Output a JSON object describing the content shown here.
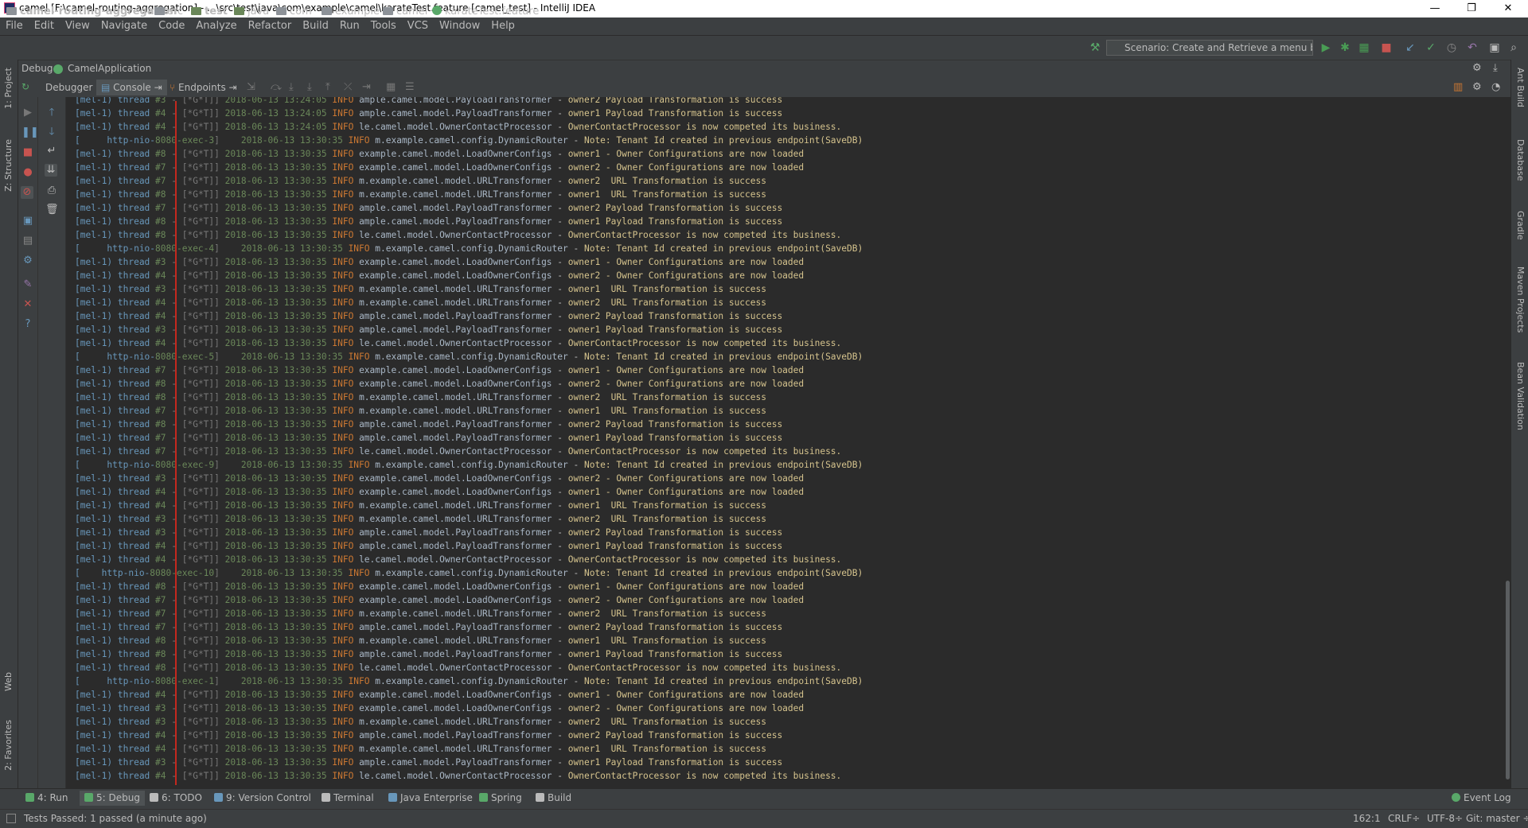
{
  "window": {
    "title": "camel [F:\\camel-routing-aggregation] - ...\\src\\test\\java\\com\\example\\camel\\karateTest.feature [camel_test] - IntelliJ IDEA",
    "controls": [
      "—",
      "❐",
      "✕"
    ]
  },
  "menu": [
    "File",
    "Edit",
    "View",
    "Navigate",
    "Code",
    "Analyze",
    "Refactor",
    "Build",
    "Run",
    "Tools",
    "VCS",
    "Window",
    "Help"
  ],
  "breadcrumbs": [
    "camel-routing-aggregation",
    "src",
    "test",
    "java",
    "com",
    "example",
    "camel",
    "karateTest.feature"
  ],
  "run_config": "Scenario: Create and Retrieve a menu by ...",
  "debug": {
    "header_label": "Debug",
    "config_name": "CamelApplication",
    "tabs": [
      "Debugger",
      "Console",
      "Endpoints"
    ]
  },
  "right_tools": [
    "Ant Build",
    "Database",
    "Gradle",
    "Maven Projects",
    "Bean Validation"
  ],
  "left_tools": [
    "1: Project",
    "Z: Structure",
    "Web",
    "2: Favorites"
  ],
  "console_lines": [
    [
      "[mel-1) thread ",
      "#3",
      " - [*G*T]] ",
      "2018-06-13 13:24:05",
      "INFO",
      "ample.camel.model.PayloadTransformer",
      "owner2 Payload Transformation is success"
    ],
    [
      "[mel-1) thread ",
      "#4",
      " - [*G*T]] ",
      "2018-06-13 13:24:05",
      "INFO",
      "ample.camel.model.PayloadTransformer",
      "owner1 Payload Transformation is success"
    ],
    [
      "[mel-1) thread ",
      "#4",
      " - [*G*T]] ",
      "2018-06-13 13:24:05",
      "INFO",
      "le.camel.model.OwnerContactProcessor",
      "OwnerContactProcessor is now competed its business."
    ],
    [
      "[     http-nio-",
      "8080-exec-3",
      "]    ",
      "2018-06-13 13:30:35",
      "INFO",
      "m.example.camel.config.DynamicRouter",
      "Note: Tenant Id created in previous endpoint(SaveDB)"
    ],
    [
      "[mel-1) thread ",
      "#8",
      " - [*G*T]] ",
      "2018-06-13 13:30:35",
      "INFO",
      "example.camel.model.LoadOwnerConfigs",
      "owner1 - Owner Configurations are now loaded"
    ],
    [
      "[mel-1) thread ",
      "#7",
      " - [*G*T]] ",
      "2018-06-13 13:30:35",
      "INFO",
      "example.camel.model.LoadOwnerConfigs",
      "owner2 - Owner Configurations are now loaded"
    ],
    [
      "[mel-1) thread ",
      "#7",
      " - [*G*T]] ",
      "2018-06-13 13:30:35",
      "INFO",
      "m.example.camel.model.URLTransformer",
      "owner2  URL Transformation is success"
    ],
    [
      "[mel-1) thread ",
      "#8",
      " - [*G*T]] ",
      "2018-06-13 13:30:35",
      "INFO",
      "m.example.camel.model.URLTransformer",
      "owner1  URL Transformation is success"
    ],
    [
      "[mel-1) thread ",
      "#7",
      " - [*G*T]] ",
      "2018-06-13 13:30:35",
      "INFO",
      "ample.camel.model.PayloadTransformer",
      "owner2 Payload Transformation is success"
    ],
    [
      "[mel-1) thread ",
      "#8",
      " - [*G*T]] ",
      "2018-06-13 13:30:35",
      "INFO",
      "ample.camel.model.PayloadTransformer",
      "owner1 Payload Transformation is success"
    ],
    [
      "[mel-1) thread ",
      "#8",
      " - [*G*T]] ",
      "2018-06-13 13:30:35",
      "INFO",
      "le.camel.model.OwnerContactProcessor",
      "OwnerContactProcessor is now competed its business."
    ],
    [
      "[     http-nio-",
      "8080-exec-4",
      "]    ",
      "2018-06-13 13:30:35",
      "INFO",
      "m.example.camel.config.DynamicRouter",
      "Note: Tenant Id created in previous endpoint(SaveDB)"
    ],
    [
      "[mel-1) thread ",
      "#3",
      " - [*G*T]] ",
      "2018-06-13 13:30:35",
      "INFO",
      "example.camel.model.LoadOwnerConfigs",
      "owner1 - Owner Configurations are now loaded"
    ],
    [
      "[mel-1) thread ",
      "#4",
      " - [*G*T]] ",
      "2018-06-13 13:30:35",
      "INFO",
      "example.camel.model.LoadOwnerConfigs",
      "owner2 - Owner Configurations are now loaded"
    ],
    [
      "[mel-1) thread ",
      "#3",
      " - [*G*T]] ",
      "2018-06-13 13:30:35",
      "INFO",
      "m.example.camel.model.URLTransformer",
      "owner1  URL Transformation is success"
    ],
    [
      "[mel-1) thread ",
      "#4",
      " - [*G*T]] ",
      "2018-06-13 13:30:35",
      "INFO",
      "m.example.camel.model.URLTransformer",
      "owner2  URL Transformation is success"
    ],
    [
      "[mel-1) thread ",
      "#4",
      " - [*G*T]] ",
      "2018-06-13 13:30:35",
      "INFO",
      "ample.camel.model.PayloadTransformer",
      "owner2 Payload Transformation is success"
    ],
    [
      "[mel-1) thread ",
      "#3",
      " - [*G*T]] ",
      "2018-06-13 13:30:35",
      "INFO",
      "ample.camel.model.PayloadTransformer",
      "owner1 Payload Transformation is success"
    ],
    [
      "[mel-1) thread ",
      "#4",
      " - [*G*T]] ",
      "2018-06-13 13:30:35",
      "INFO",
      "le.camel.model.OwnerContactProcessor",
      "OwnerContactProcessor is now competed its business."
    ],
    [
      "[     http-nio-",
      "8080-exec-5",
      "]    ",
      "2018-06-13 13:30:35",
      "INFO",
      "m.example.camel.config.DynamicRouter",
      "Note: Tenant Id created in previous endpoint(SaveDB)"
    ],
    [
      "[mel-1) thread ",
      "#7",
      " - [*G*T]] ",
      "2018-06-13 13:30:35",
      "INFO",
      "example.camel.model.LoadOwnerConfigs",
      "owner1 - Owner Configurations are now loaded"
    ],
    [
      "[mel-1) thread ",
      "#8",
      " - [*G*T]] ",
      "2018-06-13 13:30:35",
      "INFO",
      "example.camel.model.LoadOwnerConfigs",
      "owner2 - Owner Configurations are now loaded"
    ],
    [
      "[mel-1) thread ",
      "#8",
      " - [*G*T]] ",
      "2018-06-13 13:30:35",
      "INFO",
      "m.example.camel.model.URLTransformer",
      "owner2  URL Transformation is success"
    ],
    [
      "[mel-1) thread ",
      "#7",
      " - [*G*T]] ",
      "2018-06-13 13:30:35",
      "INFO",
      "m.example.camel.model.URLTransformer",
      "owner1  URL Transformation is success"
    ],
    [
      "[mel-1) thread ",
      "#8",
      " - [*G*T]] ",
      "2018-06-13 13:30:35",
      "INFO",
      "ample.camel.model.PayloadTransformer",
      "owner2 Payload Transformation is success"
    ],
    [
      "[mel-1) thread ",
      "#7",
      " - [*G*T]] ",
      "2018-06-13 13:30:35",
      "INFO",
      "ample.camel.model.PayloadTransformer",
      "owner1 Payload Transformation is success"
    ],
    [
      "[mel-1) thread ",
      "#7",
      " - [*G*T]] ",
      "2018-06-13 13:30:35",
      "INFO",
      "le.camel.model.OwnerContactProcessor",
      "OwnerContactProcessor is now competed its business."
    ],
    [
      "[     http-nio-",
      "8080-exec-9",
      "]    ",
      "2018-06-13 13:30:35",
      "INFO",
      "m.example.camel.config.DynamicRouter",
      "Note: Tenant Id created in previous endpoint(SaveDB)"
    ],
    [
      "[mel-1) thread ",
      "#3",
      " - [*G*T]] ",
      "2018-06-13 13:30:35",
      "INFO",
      "example.camel.model.LoadOwnerConfigs",
      "owner2 - Owner Configurations are now loaded"
    ],
    [
      "[mel-1) thread ",
      "#4",
      " - [*G*T]] ",
      "2018-06-13 13:30:35",
      "INFO",
      "example.camel.model.LoadOwnerConfigs",
      "owner1 - Owner Configurations are now loaded"
    ],
    [
      "[mel-1) thread ",
      "#4",
      " - [*G*T]] ",
      "2018-06-13 13:30:35",
      "INFO",
      "m.example.camel.model.URLTransformer",
      "owner1  URL Transformation is success"
    ],
    [
      "[mel-1) thread ",
      "#3",
      " - [*G*T]] ",
      "2018-06-13 13:30:35",
      "INFO",
      "m.example.camel.model.URLTransformer",
      "owner2  URL Transformation is success"
    ],
    [
      "[mel-1) thread ",
      "#3",
      " - [*G*T]] ",
      "2018-06-13 13:30:35",
      "INFO",
      "ample.camel.model.PayloadTransformer",
      "owner2 Payload Transformation is success"
    ],
    [
      "[mel-1) thread ",
      "#4",
      " - [*G*T]] ",
      "2018-06-13 13:30:35",
      "INFO",
      "ample.camel.model.PayloadTransformer",
      "owner1 Payload Transformation is success"
    ],
    [
      "[mel-1) thread ",
      "#4",
      " - [*G*T]] ",
      "2018-06-13 13:30:35",
      "INFO",
      "le.camel.model.OwnerContactProcessor",
      "OwnerContactProcessor is now competed its business."
    ],
    [
      "[    http-nio-",
      "8080-exec-10",
      "]    ",
      "2018-06-13 13:30:35",
      "INFO",
      "m.example.camel.config.DynamicRouter",
      "Note: Tenant Id created in previous endpoint(SaveDB)"
    ],
    [
      "[mel-1) thread ",
      "#8",
      " - [*G*T]] ",
      "2018-06-13 13:30:35",
      "INFO",
      "example.camel.model.LoadOwnerConfigs",
      "owner1 - Owner Configurations are now loaded"
    ],
    [
      "[mel-1) thread ",
      "#7",
      " - [*G*T]] ",
      "2018-06-13 13:30:35",
      "INFO",
      "example.camel.model.LoadOwnerConfigs",
      "owner2 - Owner Configurations are now loaded"
    ],
    [
      "[mel-1) thread ",
      "#7",
      " - [*G*T]] ",
      "2018-06-13 13:30:35",
      "INFO",
      "m.example.camel.model.URLTransformer",
      "owner2  URL Transformation is success"
    ],
    [
      "[mel-1) thread ",
      "#7",
      " - [*G*T]] ",
      "2018-06-13 13:30:35",
      "INFO",
      "ample.camel.model.PayloadTransformer",
      "owner2 Payload Transformation is success"
    ],
    [
      "[mel-1) thread ",
      "#8",
      " - [*G*T]] ",
      "2018-06-13 13:30:35",
      "INFO",
      "m.example.camel.model.URLTransformer",
      "owner1  URL Transformation is success"
    ],
    [
      "[mel-1) thread ",
      "#8",
      " - [*G*T]] ",
      "2018-06-13 13:30:35",
      "INFO",
      "ample.camel.model.PayloadTransformer",
      "owner1 Payload Transformation is success"
    ],
    [
      "[mel-1) thread ",
      "#8",
      " - [*G*T]] ",
      "2018-06-13 13:30:35",
      "INFO",
      "le.camel.model.OwnerContactProcessor",
      "OwnerContactProcessor is now competed its business."
    ],
    [
      "[     http-nio-",
      "8080-exec-1",
      "]    ",
      "2018-06-13 13:30:35",
      "INFO",
      "m.example.camel.config.DynamicRouter",
      "Note: Tenant Id created in previous endpoint(SaveDB)"
    ],
    [
      "[mel-1) thread ",
      "#4",
      " - [*G*T]] ",
      "2018-06-13 13:30:35",
      "INFO",
      "example.camel.model.LoadOwnerConfigs",
      "owner1 - Owner Configurations are now loaded"
    ],
    [
      "[mel-1) thread ",
      "#3",
      " - [*G*T]] ",
      "2018-06-13 13:30:35",
      "INFO",
      "example.camel.model.LoadOwnerConfigs",
      "owner2 - Owner Configurations are now loaded"
    ],
    [
      "[mel-1) thread ",
      "#3",
      " - [*G*T]] ",
      "2018-06-13 13:30:35",
      "INFO",
      "m.example.camel.model.URLTransformer",
      "owner2  URL Transformation is success"
    ],
    [
      "[mel-1) thread ",
      "#4",
      " - [*G*T]] ",
      "2018-06-13 13:30:35",
      "INFO",
      "ample.camel.model.PayloadTransformer",
      "owner2 Payload Transformation is success"
    ],
    [
      "[mel-1) thread ",
      "#4",
      " - [*G*T]] ",
      "2018-06-13 13:30:35",
      "INFO",
      "m.example.camel.model.URLTransformer",
      "owner1  URL Transformation is success"
    ],
    [
      "[mel-1) thread ",
      "#3",
      " - [*G*T]] ",
      "2018-06-13 13:30:35",
      "INFO",
      "ample.camel.model.PayloadTransformer",
      "owner1 Payload Transformation is success"
    ],
    [
      "[mel-1) thread ",
      "#4",
      " - [*G*T]] ",
      "2018-06-13 13:30:35",
      "INFO",
      "le.camel.model.OwnerContactProcessor",
      "OwnerContactProcessor is now competed its business."
    ]
  ],
  "bottom_tabs": [
    {
      "label": "4: Run",
      "color": "#59a869"
    },
    {
      "label": "5: Debug",
      "color": "#59a869"
    },
    {
      "label": "6: TODO",
      "color": "#bbbbbb"
    },
    {
      "label": "9: Version Control",
      "color": "#6897bb"
    },
    {
      "label": "Terminal",
      "color": "#bbbbbb"
    },
    {
      "label": "Java Enterprise",
      "color": "#6897bb"
    },
    {
      "label": "Spring",
      "color": "#59a869"
    },
    {
      "label": "Build",
      "color": "#bbbbbb"
    }
  ],
  "event_log": "Event Log",
  "status": {
    "message": "Tests Passed: 1 passed (a minute ago)",
    "position": "162:1",
    "line_sep": "CRLF÷",
    "encoding": "UTF-8÷",
    "git": "Git: master ÷"
  },
  "colors": {
    "accent_red": "#c75450",
    "run_green": "#499c54",
    "console_bg": "#2b2b2b"
  }
}
